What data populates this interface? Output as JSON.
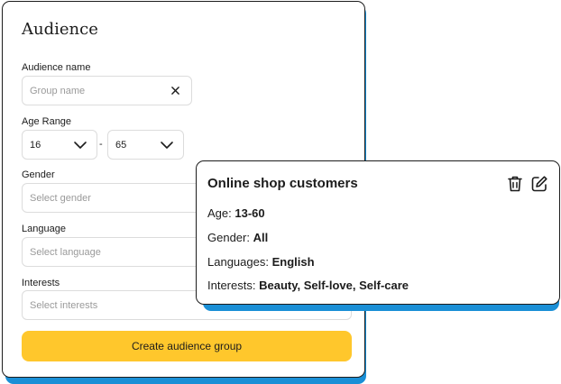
{
  "form": {
    "title": "Audience",
    "audience_name": {
      "label": "Audience name",
      "placeholder": "Group name"
    },
    "age_range": {
      "label": "Age Range",
      "min": "16",
      "max": "65",
      "separator": "-"
    },
    "gender": {
      "label": "Gender",
      "placeholder": "Select gender"
    },
    "language": {
      "label": "Language",
      "placeholder": "Select language"
    },
    "interests": {
      "label": "Interests",
      "placeholder": "Select interests"
    },
    "submit_label": "Create audience group"
  },
  "summary": {
    "title": "Online shop customers",
    "age_label": "Age:",
    "age_value": "13-60",
    "gender_label": "Gender:",
    "gender_value": "All",
    "languages_label": "Languages:",
    "languages_value": "English",
    "interests_label": "Interests:",
    "interests_value": "Beauty, Self-love, Self-care"
  },
  "colors": {
    "accent_yellow": "#ffc72c",
    "shadow_blue": "#1a8fd6",
    "border": "#1c1c1c"
  },
  "icons": [
    "close-icon",
    "chevron-down-icon",
    "trash-icon",
    "edit-icon"
  ]
}
